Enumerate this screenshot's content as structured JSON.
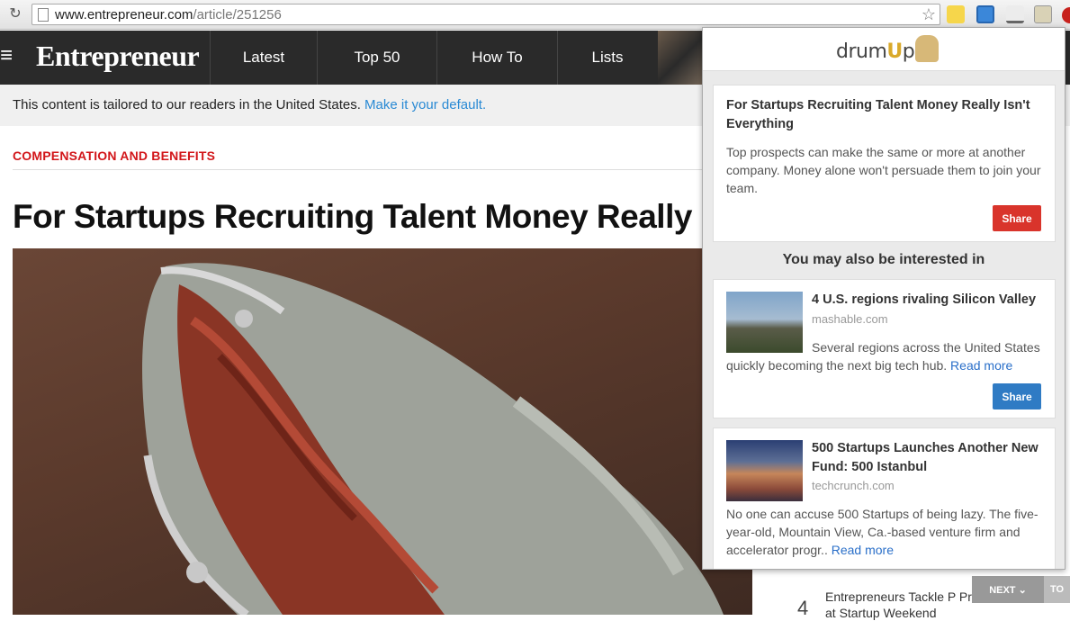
{
  "browser": {
    "url_host": "www.entrepreneur.com",
    "url_path": "/article/251256",
    "reload_glyph": "↻",
    "star_glyph": "☆",
    "extensions": [
      "puzzle-icon",
      "layout-icon",
      "download-icon",
      "drumup-icon",
      "adobe-icon"
    ]
  },
  "nav": {
    "menu_glyph": "≡",
    "logo": "Entrepreneur",
    "items": [
      {
        "label": "Latest"
      },
      {
        "label": "Top 50"
      },
      {
        "label": "How To"
      },
      {
        "label": "Lists"
      }
    ]
  },
  "tailor": {
    "text": "This content is tailored to our readers in the United States.",
    "link": "Make it your default."
  },
  "article": {
    "category": "COMPENSATION AND BENEFITS",
    "headline": "For Startups Recruiting Talent Money Really I"
  },
  "sidebar": {
    "number": "4",
    "text": "Entrepreneurs Tackle P Problems at Startup Weekend",
    "next_label": "NEXT ⌄",
    "to_label": "TO"
  },
  "popup": {
    "logo_prefix": "drum",
    "logo_u": "U",
    "logo_suffix": "p",
    "main_card": {
      "title": "For Startups Recruiting Talent Money Really Isn't Everything",
      "description": "Top prospects can make the same or more at another company. Money alone won't persuade them to join your team.",
      "share_label": "Share"
    },
    "also_heading": "You may also be interested in",
    "cards": [
      {
        "title": "4 U.S. regions rivaling Silicon Valley",
        "source": "mashable.com",
        "description": "Several regions across the United States quickly becoming the next big tech hub.",
        "read_more": "Read more",
        "share_label": "Share"
      },
      {
        "title": "500 Startups Launches Another New Fund: 500 Istanbul",
        "source": "techcrunch.com",
        "description": "No one can accuse 500 Startups of being lazy. The five-year-old, Mountain View, Ca.-based venture firm and accelerator progr..",
        "read_more": "Read more",
        "share_label": "Share"
      }
    ]
  }
}
